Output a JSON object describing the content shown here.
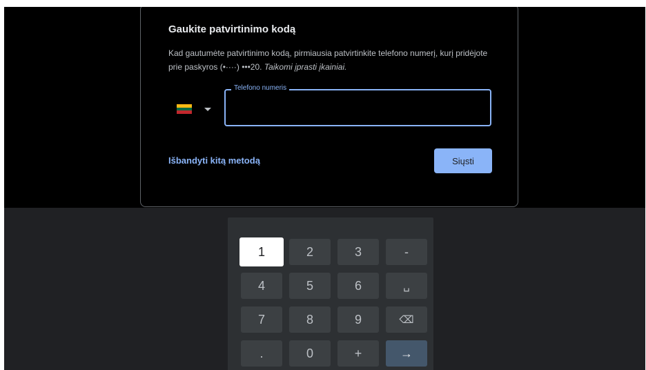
{
  "dialog": {
    "title": "Gaukite patvirtinimo kodą",
    "description_main": "Kad gautumėte patvirtinimo kodą, pirmiausia patvirtinkite telefono numerį, kurį pridėjote prie paskyros (•····) •••20.",
    "description_note": "Taikomi įprasti įkainiai.",
    "country": {
      "flag_colors": [
        "#fdb913",
        "#006a44",
        "#c1272d"
      ]
    },
    "phone_field": {
      "label": "Telefono numeris",
      "value": ""
    },
    "try_another_label": "Išbandyti kitą metodą",
    "send_label": "Siųsti"
  },
  "keypad": {
    "keys": [
      {
        "label": "1",
        "name": "key-1"
      },
      {
        "label": "2",
        "name": "key-2"
      },
      {
        "label": "3",
        "name": "key-3"
      },
      {
        "label": "-",
        "name": "key-dash"
      },
      {
        "label": "4",
        "name": "key-4"
      },
      {
        "label": "5",
        "name": "key-5"
      },
      {
        "label": "6",
        "name": "key-6"
      },
      {
        "label": "␣",
        "name": "key-space"
      },
      {
        "label": "7",
        "name": "key-7"
      },
      {
        "label": "8",
        "name": "key-8"
      },
      {
        "label": "9",
        "name": "key-9"
      },
      {
        "label": "⌫",
        "name": "key-backspace"
      },
      {
        "label": ".",
        "name": "key-dot"
      },
      {
        "label": "0",
        "name": "key-0"
      },
      {
        "label": "+",
        "name": "key-plus"
      },
      {
        "label": "→",
        "name": "key-enter"
      }
    ],
    "focused_key": "1"
  },
  "colors": {
    "accent": "#8ab4f8",
    "background": "#000000",
    "keyboard_bg": "#202124",
    "key_bg": "#3c4043"
  }
}
